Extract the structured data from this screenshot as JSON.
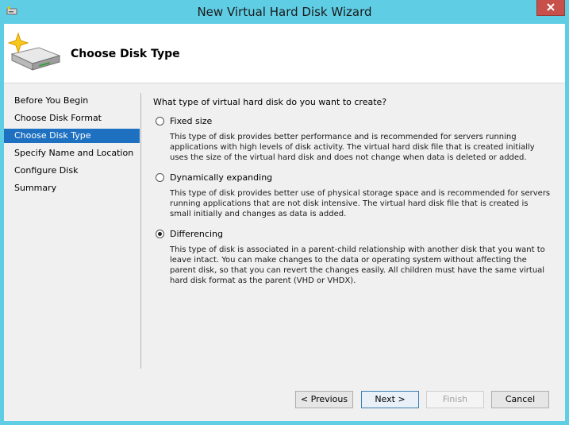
{
  "window": {
    "title": "New Virtual Hard Disk Wizard",
    "icons": {
      "system": "wizard-app-icon",
      "close": "close-icon",
      "header": "hard-disk-sparkle-icon"
    },
    "colors": {
      "frame": "#5fcde4",
      "close": "#c7504a",
      "selected_step": "#1e70c1"
    }
  },
  "header": {
    "title": "Choose Disk Type"
  },
  "steps": [
    {
      "label": "Before You Begin",
      "active": false
    },
    {
      "label": "Choose Disk Format",
      "active": false
    },
    {
      "label": "Choose Disk Type",
      "active": true
    },
    {
      "label": "Specify Name and Location",
      "active": false
    },
    {
      "label": "Configure Disk",
      "active": false
    },
    {
      "label": "Summary",
      "active": false
    }
  ],
  "content": {
    "question": "What type of virtual hard disk do you want to create?",
    "options": [
      {
        "label": "Fixed size",
        "selected": false,
        "description": "This type of disk provides better performance and is recommended for servers running applications with high levels of disk activity. The virtual hard disk file that is created initially uses the size of the virtual hard disk and does not change when data is deleted or added."
      },
      {
        "label": "Dynamically expanding",
        "selected": false,
        "description": "This type of disk provides better use of physical storage space and is recommended for servers running applications that are not disk intensive. The virtual hard disk file that is created is small initially and changes as data is added."
      },
      {
        "label": "Differencing",
        "selected": true,
        "description": "This type of disk is associated in a parent-child relationship with another disk that you want to leave intact. You can make changes to the data or operating system without affecting the parent disk, so that you can revert the changes easily. All children must have the same virtual hard disk format as the parent (VHD or VHDX)."
      }
    ]
  },
  "buttons": {
    "previous": "< Previous",
    "next": "Next >",
    "finish": "Finish",
    "cancel": "Cancel"
  }
}
